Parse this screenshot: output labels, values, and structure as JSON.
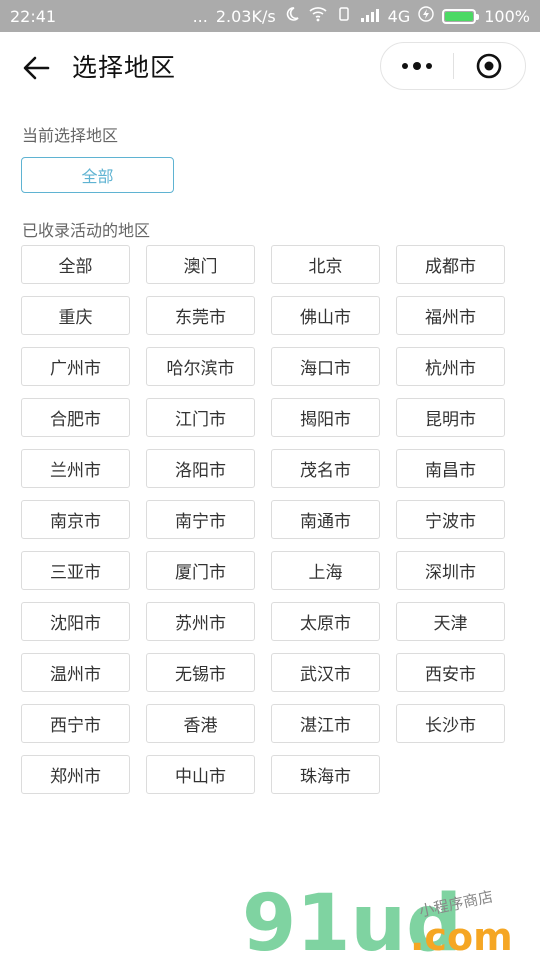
{
  "status": {
    "time": "22:41",
    "dots": "...",
    "speed": "2.03K/s",
    "network": "4G",
    "battery": "100%"
  },
  "header": {
    "title": "选择地区"
  },
  "current": {
    "label": "当前选择地区",
    "selected": "全部"
  },
  "regions": {
    "label": "已收录活动的地区",
    "items": [
      "全部",
      "澳门",
      "北京",
      "成都市",
      "重庆",
      "东莞市",
      "佛山市",
      "福州市",
      "广州市",
      "哈尔滨市",
      "海口市",
      "杭州市",
      "合肥市",
      "江门市",
      "揭阳市",
      "昆明市",
      "兰州市",
      "洛阳市",
      "茂名市",
      "南昌市",
      "南京市",
      "南宁市",
      "南通市",
      "宁波市",
      "三亚市",
      "厦门市",
      "上海",
      "深圳市",
      "沈阳市",
      "苏州市",
      "太原市",
      "天津",
      "温州市",
      "无锡市",
      "武汉市",
      "西安市",
      "西宁市",
      "香港",
      "湛江市",
      "长沙市",
      "郑州市",
      "中山市",
      "珠海市"
    ]
  },
  "watermark": {
    "brand": "91ud",
    "domain": ".com",
    "tagline": "小程序商店"
  },
  "colors": {
    "accent": "#5fb3d2",
    "battery": "#4cd964",
    "watermark_green": "#7fd3a1"
  }
}
